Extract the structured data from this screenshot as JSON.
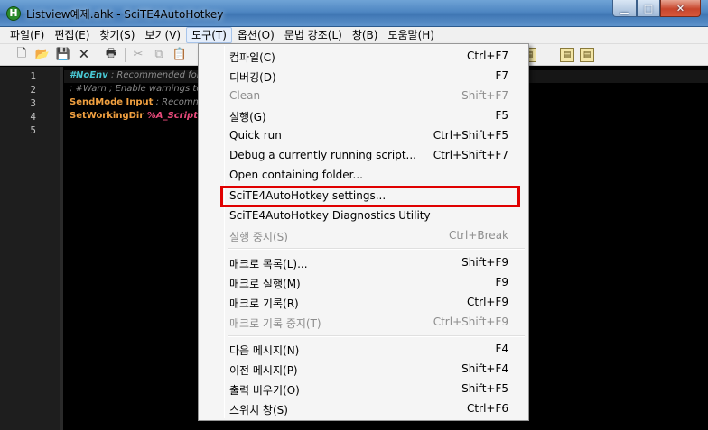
{
  "window": {
    "title": "Listview예제.ahk - SciTE4AutoHotkey",
    "app_icon": "H",
    "buttons": [
      "minimize-icon",
      "maximize-icon",
      "close-icon"
    ]
  },
  "menubar": {
    "items": [
      "파일(F)",
      "편집(E)",
      "찾기(S)",
      "보기(V)",
      "도구(T)",
      "옵션(O)",
      "문법 강조(L)",
      "창(B)",
      "도움말(H)"
    ],
    "active": "도구(T)"
  },
  "editor": {
    "line_numbers": [
      "1",
      "2",
      "3",
      "4",
      "5"
    ],
    "lines": [
      {
        "a": "#NoEnv",
        "b": " ; Recommended for p"
      },
      {
        "a": "",
        "b": "; #Warn  ; Enable warnings to a"
      },
      {
        "a": "SendMode Input",
        "b": " ; Recomme"
      },
      {
        "a": "SetWorkingDir ",
        "c": "%A_ScriptDir"
      }
    ]
  },
  "tools_menu": {
    "items": [
      {
        "label": "컴파일(C)",
        "shortcut": "Ctrl+F7",
        "enabled": true
      },
      {
        "label": "디버깅(D)",
        "shortcut": "F7",
        "enabled": true
      },
      {
        "label": "Clean",
        "shortcut": "Shift+F7",
        "enabled": false
      },
      {
        "label": "실행(G)",
        "shortcut": "F5",
        "enabled": true
      },
      {
        "label": "Quick run",
        "shortcut": "Ctrl+Shift+F5",
        "enabled": true
      },
      {
        "label": "Debug a currently running script...",
        "shortcut": "Ctrl+Shift+F7",
        "enabled": true
      },
      {
        "label": "Open containing folder...",
        "shortcut": "",
        "enabled": true
      },
      {
        "label": "SciTE4AutoHotkey settings...",
        "shortcut": "",
        "enabled": true,
        "highlighted": true
      },
      {
        "label": "SciTE4AutoHotkey Diagnostics Utility",
        "shortcut": "",
        "enabled": true
      },
      {
        "label": "실행 중지(S)",
        "shortcut": "Ctrl+Break",
        "enabled": false
      },
      {
        "label": "매크로 목록(L)...",
        "shortcut": "Shift+F9",
        "enabled": true
      },
      {
        "label": "매크로 실행(M)",
        "shortcut": "F9",
        "enabled": true
      },
      {
        "label": "매크로 기록(R)",
        "shortcut": "Ctrl+F9",
        "enabled": true
      },
      {
        "label": "매크로 기록 중지(T)",
        "shortcut": "Ctrl+Shift+F9",
        "enabled": false
      },
      {
        "label": "다음 메시지(N)",
        "shortcut": "F4",
        "enabled": true
      },
      {
        "label": "이전 메시지(P)",
        "shortcut": "Shift+F4",
        "enabled": true
      },
      {
        "label": "출력 비우기(O)",
        "shortcut": "Shift+F5",
        "enabled": true
      },
      {
        "label": "스위치 창(S)",
        "shortcut": "Ctrl+F6",
        "enabled": true
      }
    ],
    "highlight_color": "#e00000"
  },
  "toolbar": {
    "icons": [
      "new-file-icon",
      "open-folder-icon",
      "save-icon",
      "close-file-icon",
      "print-icon",
      "cut-icon",
      "copy-icon",
      "paste-icon"
    ]
  }
}
